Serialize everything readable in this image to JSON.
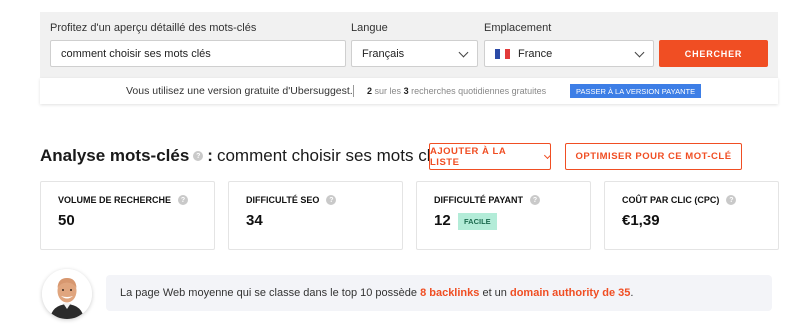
{
  "search": {
    "keyword_label": "Profitez d'un aperçu détaillé des mots-clés",
    "keyword_value": "comment choisir ses mots clés",
    "language_label": "Langue",
    "language_value": "Français",
    "location_label": "Emplacement",
    "location_value": "France",
    "search_button": "CHERCHER"
  },
  "free_bar": {
    "message": "Vous utilisez une version gratuite d'Ubersuggest.",
    "quota_used": "2",
    "quota_mid": "sur les",
    "quota_total": "3",
    "quota_suffix": "recherches quotidiennes gratuites",
    "upgrade_button": "PASSER À LA VERSION PAYANTE"
  },
  "analysis": {
    "title": "Analyse mots-clés",
    "colon": ":",
    "keyword": "comment choisir ses mots clés",
    "add_to_list_button": "AJOUTER À LA LISTE",
    "optimize_button": "OPTIMISER POUR CE MOT-CLÉ"
  },
  "metrics": [
    {
      "label": "VOLUME DE RECHERCHE",
      "value": "50"
    },
    {
      "label": "DIFFICULTÉ SEO",
      "value": "34"
    },
    {
      "label": "DIFFICULTÉ PAYANT",
      "value": "12",
      "badge": "FACILE"
    },
    {
      "label": "COÛT PAR CLIC (CPC)",
      "value": "€1,39"
    }
  ],
  "tip": {
    "text_before": "La page Web moyenne qui se classe dans le top 10 possède",
    "backlinks": "8 backlinks",
    "text_mid": "et un",
    "authority": "domain authority de 35",
    "text_end": "."
  },
  "colors": {
    "accent": "#f04e23",
    "upgrade": "#3d7ee6",
    "badge_bg": "#b3ecd8",
    "panel_bg": "#f1f1f1"
  },
  "icons": {
    "help": "question-circle-icon",
    "dropdown": "chevron-down-icon",
    "flag": "france-flag-icon"
  }
}
